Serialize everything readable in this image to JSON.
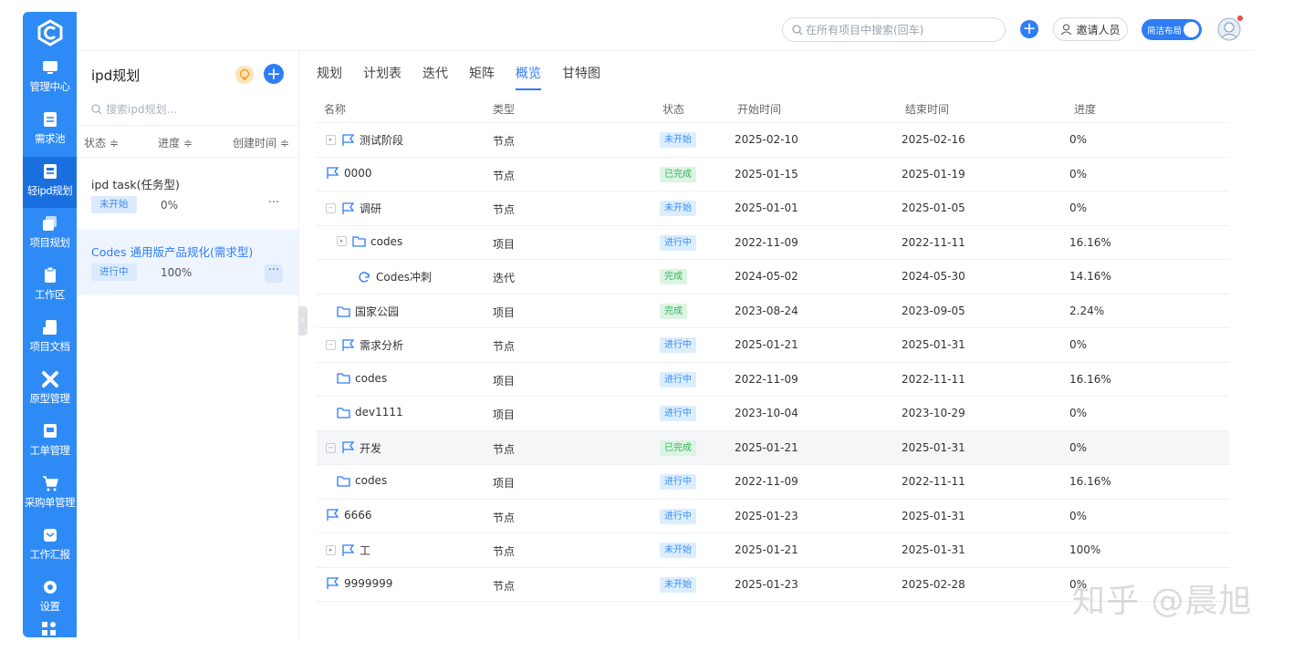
{
  "nav": {
    "items": [
      {
        "label": "管理中心",
        "icon": "monitor-icon"
      },
      {
        "label": "需求池",
        "icon": "document-icon"
      },
      {
        "label": "轻ipd规划",
        "icon": "plan-icon",
        "active": true
      },
      {
        "label": "项目规划",
        "icon": "stack-icon"
      },
      {
        "label": "工作区",
        "icon": "clipboard-icon"
      },
      {
        "label": "项目文档",
        "icon": "file-icon"
      },
      {
        "label": "原型管理",
        "icon": "tools-icon"
      },
      {
        "label": "工单管理",
        "icon": "ticket-icon"
      },
      {
        "label": "采购单管理",
        "icon": "cart-icon"
      },
      {
        "label": "工作汇报",
        "icon": "report-icon"
      },
      {
        "label": "设置",
        "icon": "gear-icon"
      }
    ]
  },
  "topbar": {
    "search_placeholder": "在所有项目中搜索(回车)",
    "invite_label": "邀请人员",
    "layout_toggle_label": "简洁布局"
  },
  "panel": {
    "title": "ipd规划",
    "search_placeholder": "搜索ipd规划...",
    "sort": {
      "status": "状态 ≑",
      "progress": "进度 ≑",
      "created": "创建时间 ≑"
    },
    "plans": [
      {
        "name": "ipd task(任务型)",
        "status": "未开始",
        "progress": "0%",
        "more": "···"
      },
      {
        "name": "Codes 通用版产品规化(需求型)",
        "status": "进行中",
        "progress": "100%",
        "more": "···"
      }
    ]
  },
  "tabs": [
    "规划",
    "计划表",
    "迭代",
    "矩阵",
    "概览",
    "甘特图"
  ],
  "table": {
    "headers": {
      "name": "名称",
      "type": "类型",
      "status": "状态",
      "start": "开始时间",
      "end": "结束时间",
      "progress": "进度"
    },
    "rows": [
      {
        "name": "测试阶段",
        "icon": "flag-icon",
        "indent": 0,
        "expander": true,
        "type": "节点",
        "status": "未开始",
        "status_color": "blue",
        "start": "2025-02-10",
        "end": "2025-02-16",
        "progress": "0%"
      },
      {
        "name": "0000",
        "icon": "flag-icon",
        "indent": 0,
        "expander": false,
        "type": "节点",
        "status": "已完成",
        "status_color": "green",
        "start": "2025-01-15",
        "end": "2025-01-19",
        "progress": "0%"
      },
      {
        "name": "调研",
        "icon": "flag-icon",
        "indent": 0,
        "expander": true,
        "type": "节点",
        "status": "未开始",
        "status_color": "blue",
        "start": "2025-01-01",
        "end": "2025-01-05",
        "progress": "0%"
      },
      {
        "name": "codes",
        "icon": "folder-icon",
        "indent": 1,
        "expander": true,
        "type": "项目",
        "status": "进行中",
        "status_color": "blue",
        "start": "2022-11-09",
        "end": "2022-11-11",
        "progress": "16.16%"
      },
      {
        "name": "Codes冲刺",
        "icon": "sprint-icon",
        "indent": 2,
        "expander": false,
        "type": "迭代",
        "status": "完成",
        "status_color": "green",
        "start": "2024-05-02",
        "end": "2024-05-30",
        "progress": "14.16%"
      },
      {
        "name": "国家公园",
        "icon": "folder-icon",
        "indent": 1,
        "expander": false,
        "type": "项目",
        "status": "完成",
        "status_color": "green",
        "start": "2023-08-24",
        "end": "2023-09-05",
        "progress": "2.24%"
      },
      {
        "name": "需求分析",
        "icon": "flag-icon",
        "indent": 0,
        "expander": true,
        "type": "节点",
        "status": "进行中",
        "status_color": "blue",
        "start": "2025-01-21",
        "end": "2025-01-31",
        "progress": "0%"
      },
      {
        "name": "codes",
        "icon": "folder-icon",
        "indent": 1,
        "expander": false,
        "type": "项目",
        "status": "进行中",
        "status_color": "blue",
        "start": "2022-11-09",
        "end": "2022-11-11",
        "progress": "16.16%"
      },
      {
        "name": "dev1111",
        "icon": "folder-icon",
        "indent": 1,
        "expander": false,
        "type": "项目",
        "status": "进行中",
        "status_color": "blue",
        "start": "2023-10-04",
        "end": "2023-10-29",
        "progress": "0%"
      },
      {
        "name": "开发",
        "icon": "flag-icon",
        "indent": 0,
        "expander": true,
        "type": "节点",
        "status": "已完成",
        "status_color": "green",
        "start": "2025-01-21",
        "end": "2025-01-31",
        "progress": "0%",
        "highlight": true
      },
      {
        "name": "codes",
        "icon": "folder-icon",
        "indent": 1,
        "expander": false,
        "type": "项目",
        "status": "进行中",
        "status_color": "blue",
        "start": "2022-11-09",
        "end": "2022-11-11",
        "progress": "16.16%"
      },
      {
        "name": "6666",
        "icon": "flag-icon",
        "indent": 0,
        "expander": false,
        "type": "节点",
        "status": "进行中",
        "status_color": "blue",
        "start": "2025-01-23",
        "end": "2025-01-31",
        "progress": "0%"
      },
      {
        "name": "工",
        "icon": "flag-icon",
        "indent": 0,
        "expander": true,
        "type": "节点",
        "status": "未开始",
        "status_color": "blue",
        "start": "2025-01-21",
        "end": "2025-01-31",
        "progress": "100%"
      },
      {
        "name": "9999999",
        "icon": "flag-icon",
        "indent": 0,
        "expander": false,
        "type": "节点",
        "status": "未开始",
        "status_color": "blue",
        "start": "2025-01-23",
        "end": "2025-02-28",
        "progress": "0%"
      }
    ]
  },
  "watermark": "知乎 @晨旭",
  "colors": {
    "brand": "#2e8bf5",
    "accent": "#2e7cf6"
  }
}
